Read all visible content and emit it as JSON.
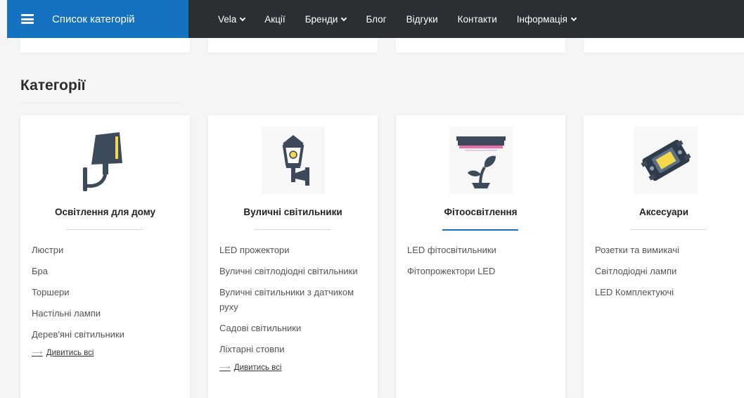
{
  "header": {
    "category_menu_label": "Список категорій",
    "nav": [
      {
        "label": "Vela",
        "dropdown": true
      },
      {
        "label": "Акції",
        "dropdown": false
      },
      {
        "label": "Бренди",
        "dropdown": true
      },
      {
        "label": "Блог",
        "dropdown": false
      },
      {
        "label": "Відгуки",
        "dropdown": false
      },
      {
        "label": "Контакти",
        "dropdown": false
      },
      {
        "label": "Інформація",
        "dropdown": true
      }
    ]
  },
  "section_title": "Категорії",
  "colors": {
    "accent": "#1572c0",
    "topbar": "#2b2e32",
    "icon_slate": "#3d4a5c",
    "icon_yellow": "#f3d64a"
  },
  "categories": [
    {
      "title": "Освітлення для дому",
      "icon": "wall-sconce-icon",
      "active": false,
      "links": [
        "Люстри",
        "Бра",
        "Торшери",
        "Настільні лампи",
        "Дерев'яні світильники"
      ],
      "see_all": "Дивитись всі"
    },
    {
      "title": "Вуличні світильники",
      "icon": "street-lantern-icon",
      "active": false,
      "links": [
        "LED прожектори",
        "Вуличні світлодіодні світильники",
        "Вуличні світильники з датчиком руху",
        "Садові світильники",
        "Ліхтарні стовпи"
      ],
      "see_all": "Дивитись всі"
    },
    {
      "title": "Фітоосвітлення",
      "icon": "grow-light-plant-icon",
      "active": true,
      "links": [
        "LED фітосвітильники",
        "Фітопрожектори LED"
      ],
      "see_all": ""
    },
    {
      "title": "Аксесуари",
      "icon": "led-chip-icon",
      "active": false,
      "links": [
        "Розетки та вимикачі",
        "Світлодіодні лампи",
        "LED Комплектуючі"
      ],
      "see_all": ""
    }
  ]
}
